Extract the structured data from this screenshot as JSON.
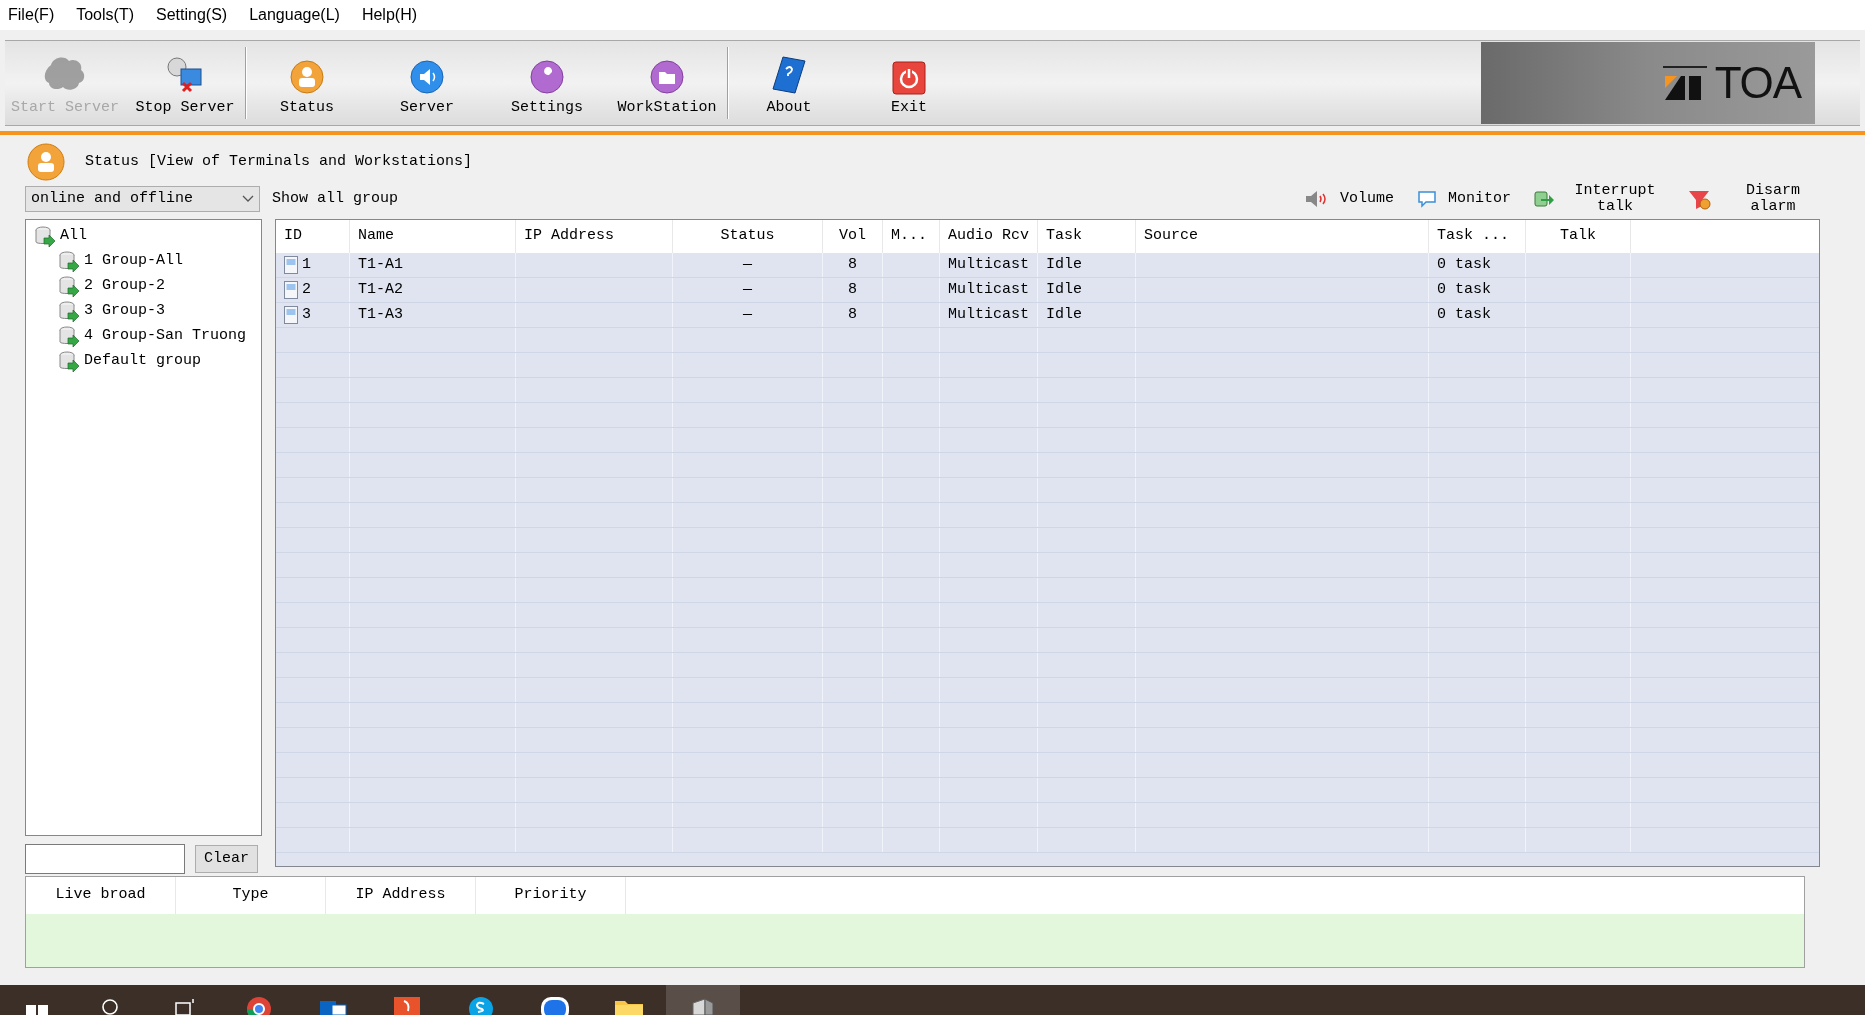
{
  "menu": [
    "File(F)",
    "Tools(T)",
    "Setting(S)",
    "Language(L)",
    "Help(H)"
  ],
  "toolbar": [
    {
      "label": "Start Server",
      "kind": "start",
      "disabled": true
    },
    {
      "label": "Stop Server",
      "kind": "stop",
      "disabled": false
    },
    {
      "label": "Status",
      "kind": "status",
      "disabled": false,
      "group_start": true
    },
    {
      "label": "Server",
      "kind": "server",
      "disabled": false
    },
    {
      "label": "Settings",
      "kind": "settings",
      "disabled": false
    },
    {
      "label": "WorkStation",
      "kind": "workstation",
      "disabled": false
    },
    {
      "label": "About",
      "kind": "about",
      "disabled": false,
      "group_start": true
    },
    {
      "label": "Exit",
      "kind": "exit",
      "disabled": false
    }
  ],
  "logo": {
    "text": "TOA"
  },
  "panel_title": "Status [View of Terminals and Workstations]",
  "filter": {
    "value": "online and offline"
  },
  "group_caption": "Show all group",
  "actions": [
    {
      "label": "Volume",
      "kind": "volume"
    },
    {
      "label": "Monitor",
      "kind": "monitor"
    },
    {
      "label": "Interrupt talk",
      "kind": "interrupt"
    },
    {
      "label": "Disarm alarm",
      "kind": "disarm"
    }
  ],
  "tree": {
    "label": "All",
    "children": [
      {
        "label": "1 Group-All"
      },
      {
        "label": "2 Group-2"
      },
      {
        "label": "3 Group-3"
      },
      {
        "label": "4 Group-San Truong"
      },
      {
        "label": "Default group"
      }
    ]
  },
  "clear_button": "Clear",
  "table": {
    "columns": [
      "ID",
      "Name",
      "IP Address",
      "Status",
      "Vol",
      "M...",
      "Audio Rcv",
      "Task",
      "Source",
      "Task ...",
      "Talk"
    ],
    "rows": [
      [
        "1",
        "T1-A1",
        "",
        "—",
        "8",
        "",
        "Multicast",
        "Idle",
        "",
        "0 task",
        ""
      ],
      [
        "2",
        "T1-A2",
        "",
        "—",
        "8",
        "",
        "Multicast",
        "Idle",
        "",
        "0 task",
        ""
      ],
      [
        "3",
        "T1-A3",
        "",
        "—",
        "8",
        "",
        "Multicast",
        "Idle",
        "",
        "0 task",
        ""
      ]
    ]
  },
  "broadcast_table": {
    "columns": [
      "Live broad",
      "Type",
      "IP Address",
      "Priority"
    ]
  },
  "taskbar": [
    {
      "kind": "windows",
      "selected": false
    },
    {
      "kind": "search",
      "selected": false
    },
    {
      "kind": "taskview",
      "selected": false
    },
    {
      "kind": "chrome",
      "selected": false
    },
    {
      "kind": "mail",
      "selected": false
    },
    {
      "kind": "pdf",
      "selected": false
    },
    {
      "kind": "skype",
      "selected": false
    },
    {
      "kind": "zalo",
      "selected": false
    },
    {
      "kind": "folder",
      "selected": false
    },
    {
      "kind": "app",
      "selected": true
    }
  ]
}
